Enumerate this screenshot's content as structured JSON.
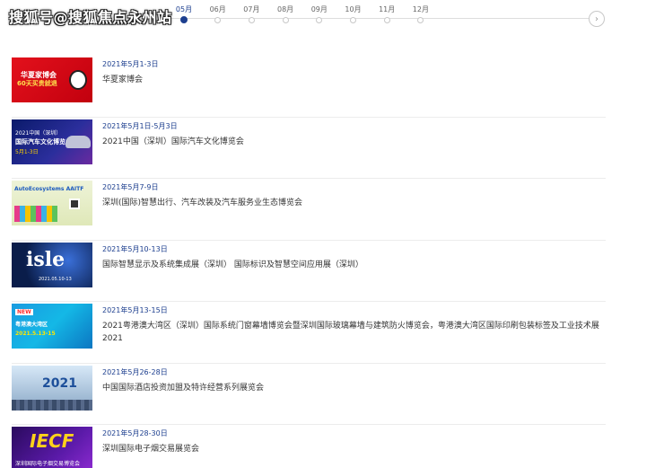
{
  "watermark": "搜狐号@搜狐焦点永州站",
  "timeline": {
    "months": [
      {
        "label": "05月",
        "active": true
      },
      {
        "label": "06月",
        "active": false
      },
      {
        "label": "07月",
        "active": false
      },
      {
        "label": "08月",
        "active": false
      },
      {
        "label": "09月",
        "active": false
      },
      {
        "label": "10月",
        "active": false
      },
      {
        "label": "11月",
        "active": false
      },
      {
        "label": "12月",
        "active": false
      }
    ],
    "next_icon": "chevron-right-icon",
    "next_glyph": "›"
  },
  "events": [
    {
      "date": "2021年5月1-3日",
      "title": "华夏家博会",
      "thumb": {
        "line1": "华夏家博会",
        "line2": "60天买贵就退"
      }
    },
    {
      "date": "2021年5月1日-5月3日",
      "title": "2021中国（深圳）国际汽车文化博览会",
      "thumb": {
        "line1": "2021中国（深圳）",
        "line2": "国际汽车文化博览会",
        "line3": "5月1-3日"
      }
    },
    {
      "date": "2021年5月7-9日",
      "title": "深圳(国际)智慧出行、汽车改装及汽车服务业生态博览会",
      "thumb": {
        "line1": "AutoEcosystems AAITF"
      }
    },
    {
      "date": "2021年5月10-13日",
      "title": "国际智慧显示及系统集成展（深圳） 国际标识及智慧空间应用展（深圳）",
      "thumb": {
        "line1": "isle",
        "line2": "2021.05.10-13"
      }
    },
    {
      "date": "2021年5月13-15日",
      "title": "2021粤港澳大湾区（深圳）国际系统门窗幕墙博览会暨深圳国际玻璃幕墙与建筑防火博览会，粤港澳大湾区国际印刷包装标签及工业技术展2021",
      "thumb": {
        "line1": "NEW",
        "line2": "粤港澳大湾区",
        "line3": "2021.5.13-15"
      }
    },
    {
      "date": "2021年5月26-28日",
      "title": "中国国际酒店投资加盟及特许经营系列展览会",
      "thumb": {
        "line1": "2021"
      }
    },
    {
      "date": "2021年5月28-30日",
      "title": "深圳国际电子烟交易展览会",
      "thumb": {
        "line1": "IECF",
        "line2": "深圳国际电子烟交易博览会"
      }
    }
  ]
}
